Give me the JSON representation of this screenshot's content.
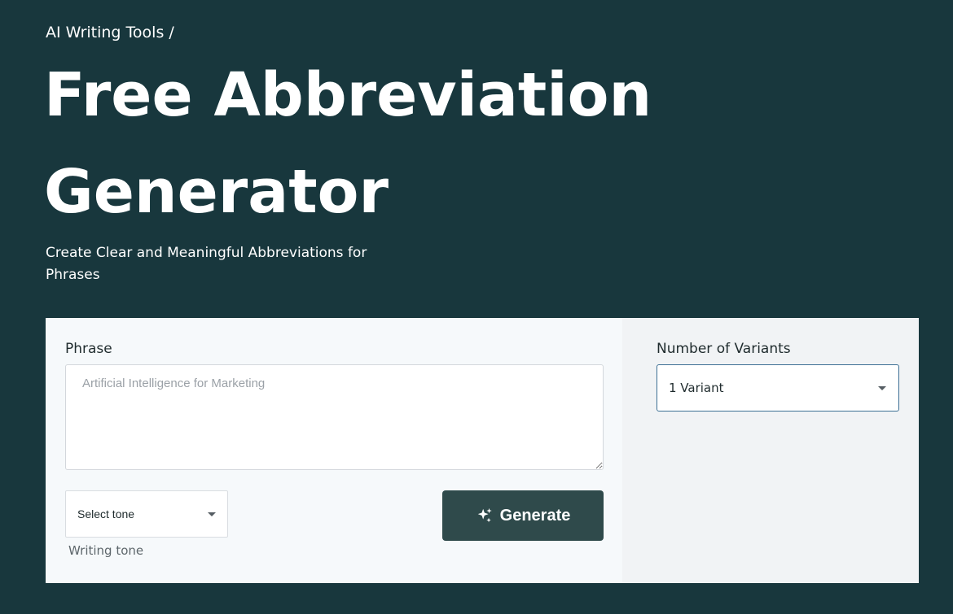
{
  "header": {
    "breadcrumb_link": "AI Writing Tools",
    "breadcrumb_separator": "/",
    "title": "Free Abbreviation Generator",
    "subtitle": "Create Clear and Meaningful Abbreviations for Phrases"
  },
  "form": {
    "phrase": {
      "label": "Phrase",
      "value": "",
      "placeholder": "Artificial Intelligence for Marketing"
    },
    "tone": {
      "selected": "Select tone",
      "helper": "Writing tone"
    },
    "generate_button": {
      "label": "Generate",
      "icon": "sparkle-icon"
    },
    "variants": {
      "label": "Number of Variants",
      "selected": "1 Variant"
    }
  },
  "colors": {
    "page_background": "#18373d",
    "panel_left": "#f6f9fb",
    "panel_right": "#f1f3f5",
    "button": "#2f4a4b",
    "focus_border": "#3d6f94"
  }
}
